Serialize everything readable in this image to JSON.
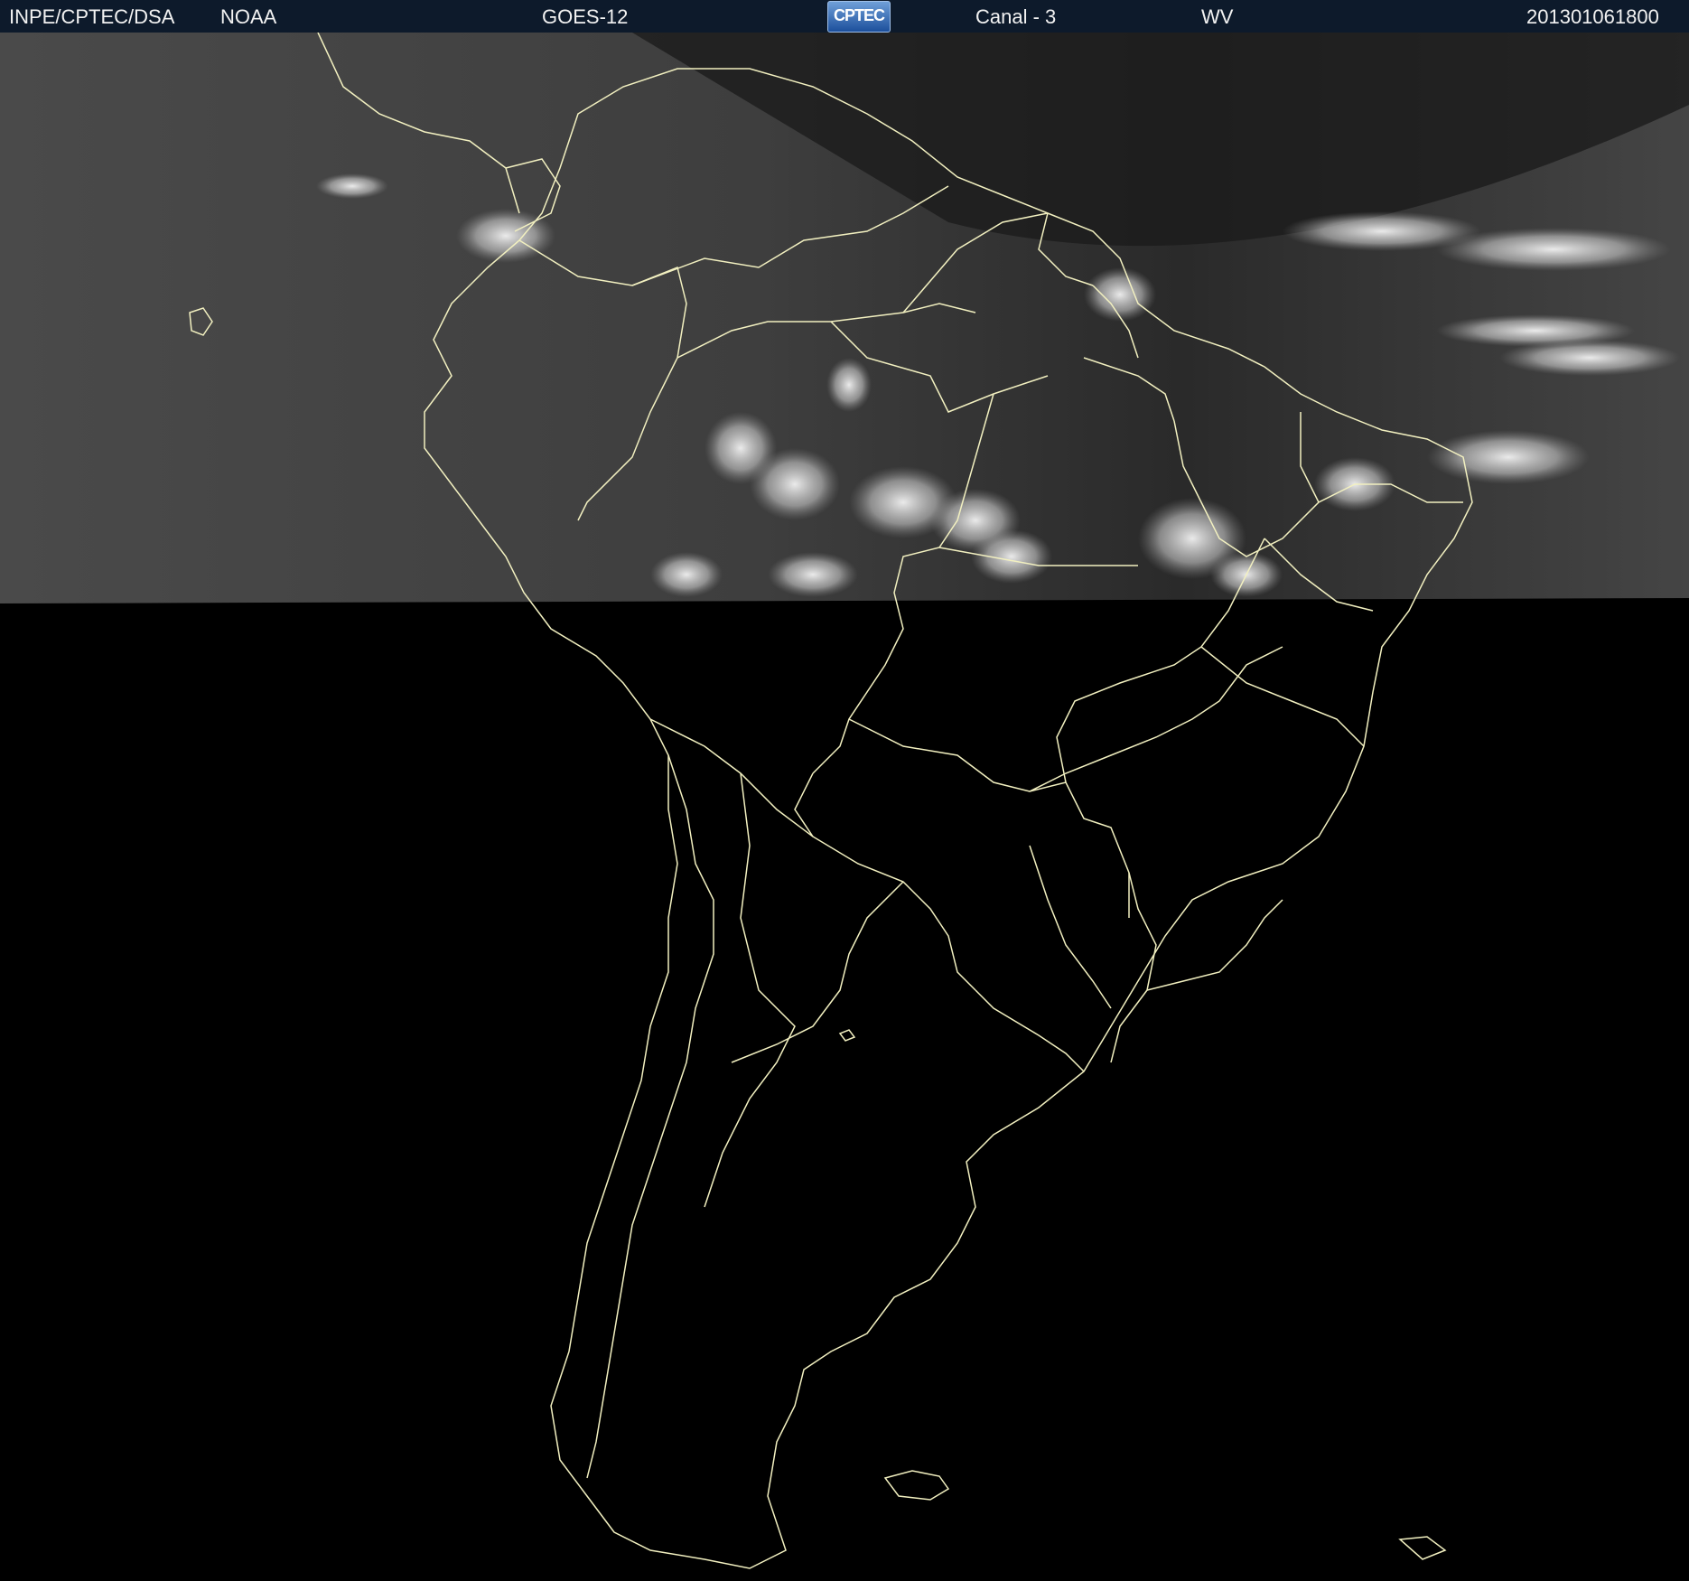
{
  "header": {
    "institution": "INPE/CPTEC/DSA",
    "agency": "NOAA",
    "satellite": "GOES-12",
    "logo_text": "CPTEC",
    "channel": "Canal - 3",
    "band": "WV",
    "timestamp": "201301061800"
  },
  "map": {
    "region": "South America",
    "imagery": "water vapor satellite imagery",
    "coverage": "northern portion only; southern portion black (no data)"
  },
  "colors": {
    "header_bg": "#0d1a2b",
    "border_lines": "#f2f0c0",
    "no_data": "#000000"
  }
}
